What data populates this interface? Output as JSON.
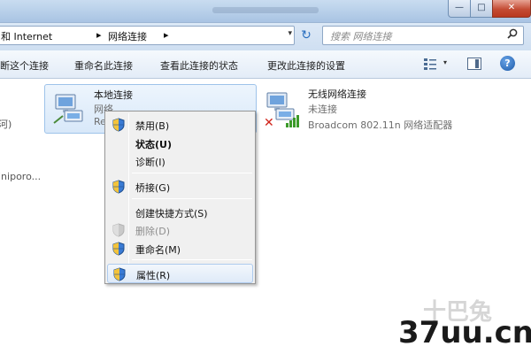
{
  "window": {
    "title_blurred": true,
    "minimize_glyph": "—",
    "maximize_glyph": "□",
    "close_glyph": "✕"
  },
  "address": {
    "crumb_1": "和 Internet",
    "crumb_2": "网络连接",
    "separator": "▸",
    "dropdown_glyph": "▾",
    "refresh_glyph": "↻"
  },
  "search": {
    "placeholder": "搜索 网络连接",
    "icon": "search-icon"
  },
  "commands": {
    "disable": "断这个连接",
    "rename": "重命名此连接",
    "view_status": "查看此连接的状态",
    "change_settings": "更改此连接的设置",
    "view_dropdown_glyph": "▾",
    "help_glyph": "?"
  },
  "left_partial": {
    "line_1": "河)",
    "line_2": "iniporo..."
  },
  "connections": [
    {
      "name": "本地连接",
      "status": "网络",
      "adapter": "Re",
      "icon": "wired-network-icon"
    },
    {
      "name": "无线网络连接",
      "status": "未连接",
      "adapter": "Broadcom 802.11n 网络适配器",
      "icon": "wireless-network-icon",
      "disconnected_glyph": "✕"
    }
  ],
  "context_menu": {
    "items": [
      {
        "label": "禁用(B)",
        "icon": "uac-shield-icon"
      },
      {
        "label": "状态(U)",
        "bold": true
      },
      {
        "label": "诊断(I)"
      },
      {
        "label": "桥接(G)",
        "icon": "uac-shield-icon"
      },
      {
        "label": "创建快捷方式(S)"
      },
      {
        "label": "删除(D)",
        "icon": "uac-shield-icon",
        "disabled": true
      },
      {
        "label": "重命名(M)",
        "icon": "uac-shield-icon"
      },
      {
        "label": "属性(R)",
        "icon": "uac-shield-icon",
        "highlighted": true
      }
    ]
  },
  "watermark": {
    "text": "37uu.cn",
    "faint_text": "十巴兔"
  },
  "colors": {
    "accent": "#2a6fbf",
    "menu_highlight": "#dfeaf8",
    "tile_selected": "#d8e8f9",
    "disconnected_red": "#d0241b",
    "signal_green": "#3c9a2a"
  }
}
